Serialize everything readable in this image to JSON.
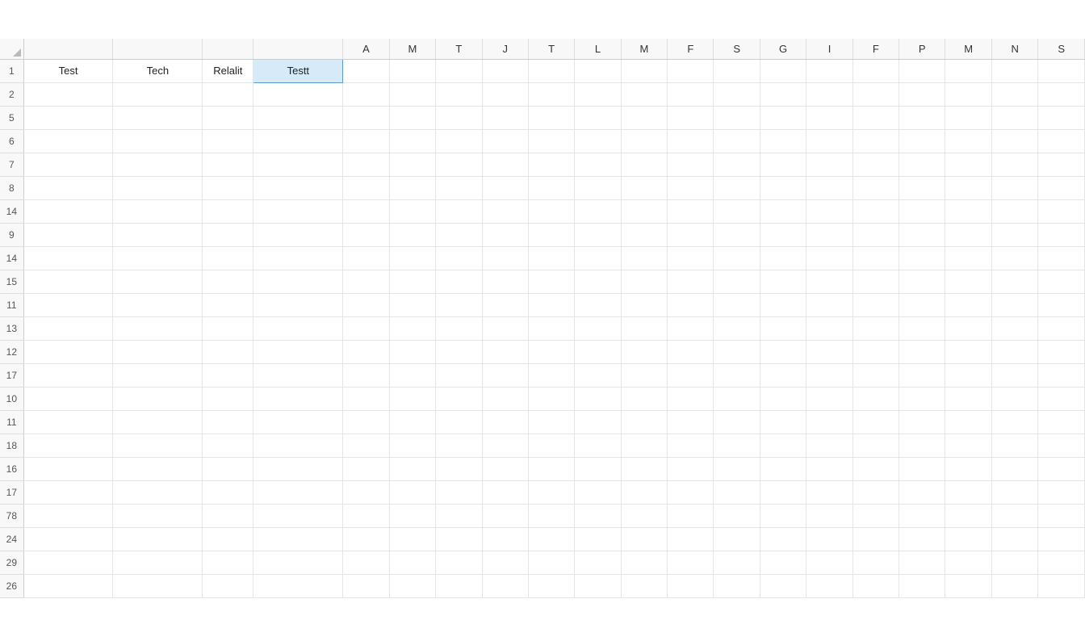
{
  "columnHeaders": {
    "wide": [
      "",
      "",
      "",
      ""
    ],
    "narrow": [
      "A",
      "M",
      "T",
      "J",
      "T",
      "L",
      "M",
      "F",
      "S",
      "G",
      "I",
      "F",
      "P",
      "M",
      "N",
      "S"
    ]
  },
  "rowHeaders": [
    "1",
    "2",
    "5",
    "6",
    "7",
    "8",
    "14",
    "9",
    "14",
    "15",
    "11",
    "13",
    "12",
    "17",
    "10",
    "11",
    "18",
    "16",
    "17",
    "78",
    "24",
    "29",
    "26"
  ],
  "cells": {
    "r0c0": "Test",
    "r0c1": "Tech",
    "r0c2": "Relalit",
    "r0c3": "Testt"
  },
  "selectedCell": "r0c3"
}
